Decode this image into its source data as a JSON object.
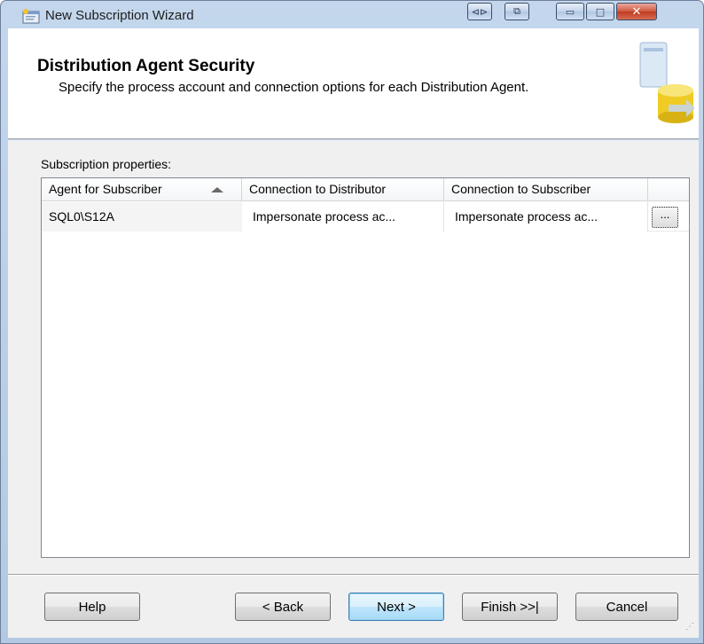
{
  "window": {
    "title": "New Subscription Wizard",
    "title_icon": "wizard-app-icon",
    "controls": {
      "extra1": "⊲⊳",
      "extra2": "⧉",
      "minimize": "▭",
      "maximize": "□",
      "close": "✕"
    }
  },
  "header": {
    "title": "Distribution Agent Security",
    "description": "Specify the process account and connection options for each Distribution Agent.",
    "art_icon": "database-security-icon"
  },
  "content": {
    "section_label": "Subscription properties:",
    "grid": {
      "columns": [
        "Agent for Subscriber",
        "Connection to Distributor",
        "Connection to Subscriber"
      ],
      "sort_icon": "sort-ascending-icon",
      "rows": [
        {
          "agent": "SQL0\\S12A",
          "distributor": "Impersonate process ac...",
          "subscriber": "Impersonate process ac...",
          "edit_button": "..."
        }
      ]
    }
  },
  "footer": {
    "help": "Help",
    "back": "< Back",
    "next": "Next >",
    "finish": "Finish >>|",
    "cancel": "Cancel"
  },
  "colors": {
    "window_frame": "#b3c9e3",
    "close_button": "#c03a1f",
    "default_button": "#3c7fb1"
  }
}
